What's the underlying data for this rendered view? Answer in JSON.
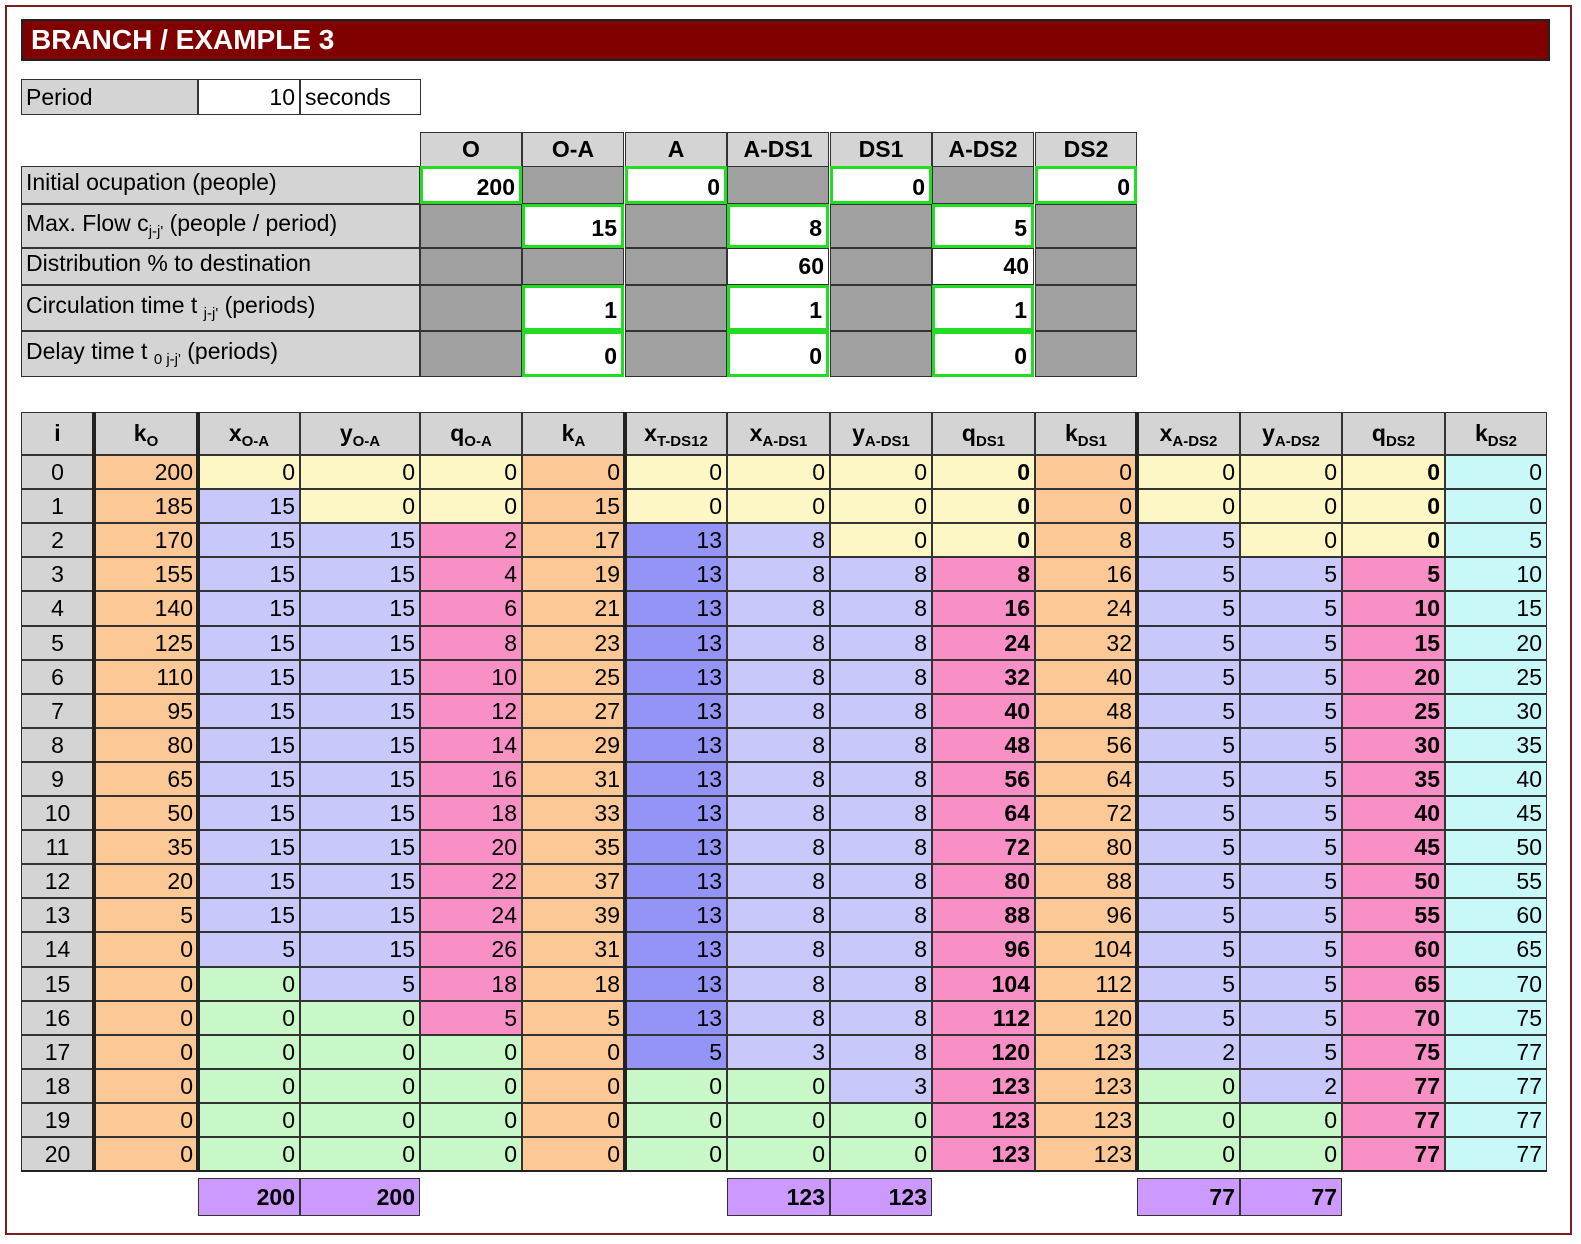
{
  "title": "BRANCH / EXAMPLE 3",
  "period": {
    "label": "Period",
    "value": "10",
    "unit": "seconds"
  },
  "params": {
    "columns": [
      "O",
      "O-A",
      "A",
      "A-DS1",
      "DS1",
      "A-DS2",
      "DS2"
    ],
    "rows": [
      {
        "label": "Initial ocupation (people)",
        "cells": [
          "200",
          null,
          "0",
          null,
          "0",
          null,
          "0"
        ]
      },
      {
        "label": "Max. Flow c",
        "sub": "j-j'",
        "label_after": " (people / period)",
        "cells": [
          null,
          "15",
          null,
          "8",
          null,
          "5",
          null
        ]
      },
      {
        "label": "Distribution %  to destination",
        "cells": [
          null,
          "",
          null,
          "60",
          null,
          "40",
          null
        ]
      },
      {
        "label": "Circulation time t ",
        "sub": "j-j'",
        "label_after": " (periods)",
        "cells": [
          null,
          "1",
          null,
          "1",
          null,
          "1",
          null
        ]
      },
      {
        "label": "Delay time t ",
        "sub": "0 j-j'",
        "label_after": " (periods)",
        "cells": [
          null,
          "0",
          null,
          "0",
          null,
          "0",
          null
        ]
      }
    ]
  },
  "table": {
    "headers": [
      {
        "main": "i",
        "sub": ""
      },
      {
        "main": "k",
        "sub": "O"
      },
      {
        "main": "x",
        "sub": "O-A"
      },
      {
        "main": "y",
        "sub": "O-A"
      },
      {
        "main": "q",
        "sub": "O-A"
      },
      {
        "main": "k",
        "sub": "A"
      },
      {
        "main": "x",
        "sub": "T-DS12"
      },
      {
        "main": "x",
        "sub": "A-DS1"
      },
      {
        "main": "y",
        "sub": "A-DS1"
      },
      {
        "main": "q",
        "sub": "DS1"
      },
      {
        "main": "k",
        "sub": "DS1"
      },
      {
        "main": "x",
        "sub": "A-DS2"
      },
      {
        "main": "y",
        "sub": "A-DS2"
      },
      {
        "main": "q",
        "sub": "DS2"
      },
      {
        "main": "k",
        "sub": "DS2"
      }
    ],
    "rows": [
      [
        "0",
        "200",
        "0",
        "0",
        "0",
        "0",
        "0",
        "0",
        "0",
        "0",
        "0",
        "0",
        "0",
        "0",
        "0"
      ],
      [
        "1",
        "185",
        "15",
        "0",
        "0",
        "15",
        "0",
        "0",
        "0",
        "0",
        "0",
        "0",
        "0",
        "0",
        "0"
      ],
      [
        "2",
        "170",
        "15",
        "15",
        "2",
        "17",
        "13",
        "8",
        "0",
        "0",
        "8",
        "5",
        "0",
        "0",
        "5"
      ],
      [
        "3",
        "155",
        "15",
        "15",
        "4",
        "19",
        "13",
        "8",
        "8",
        "8",
        "16",
        "5",
        "5",
        "5",
        "10"
      ],
      [
        "4",
        "140",
        "15",
        "15",
        "6",
        "21",
        "13",
        "8",
        "8",
        "16",
        "24",
        "5",
        "5",
        "10",
        "15"
      ],
      [
        "5",
        "125",
        "15",
        "15",
        "8",
        "23",
        "13",
        "8",
        "8",
        "24",
        "32",
        "5",
        "5",
        "15",
        "20"
      ],
      [
        "6",
        "110",
        "15",
        "15",
        "10",
        "25",
        "13",
        "8",
        "8",
        "32",
        "40",
        "5",
        "5",
        "20",
        "25"
      ],
      [
        "7",
        "95",
        "15",
        "15",
        "12",
        "27",
        "13",
        "8",
        "8",
        "40",
        "48",
        "5",
        "5",
        "25",
        "30"
      ],
      [
        "8",
        "80",
        "15",
        "15",
        "14",
        "29",
        "13",
        "8",
        "8",
        "48",
        "56",
        "5",
        "5",
        "30",
        "35"
      ],
      [
        "9",
        "65",
        "15",
        "15",
        "16",
        "31",
        "13",
        "8",
        "8",
        "56",
        "64",
        "5",
        "5",
        "35",
        "40"
      ],
      [
        "10",
        "50",
        "15",
        "15",
        "18",
        "33",
        "13",
        "8",
        "8",
        "64",
        "72",
        "5",
        "5",
        "40",
        "45"
      ],
      [
        "11",
        "35",
        "15",
        "15",
        "20",
        "35",
        "13",
        "8",
        "8",
        "72",
        "80",
        "5",
        "5",
        "45",
        "50"
      ],
      [
        "12",
        "20",
        "15",
        "15",
        "22",
        "37",
        "13",
        "8",
        "8",
        "80",
        "88",
        "5",
        "5",
        "50",
        "55"
      ],
      [
        "13",
        "5",
        "15",
        "15",
        "24",
        "39",
        "13",
        "8",
        "8",
        "88",
        "96",
        "5",
        "5",
        "55",
        "60"
      ],
      [
        "14",
        "0",
        "5",
        "15",
        "26",
        "31",
        "13",
        "8",
        "8",
        "96",
        "104",
        "5",
        "5",
        "60",
        "65"
      ],
      [
        "15",
        "0",
        "0",
        "5",
        "18",
        "18",
        "13",
        "8",
        "8",
        "104",
        "112",
        "5",
        "5",
        "65",
        "70"
      ],
      [
        "16",
        "0",
        "0",
        "0",
        "5",
        "5",
        "13",
        "8",
        "8",
        "112",
        "120",
        "5",
        "5",
        "70",
        "75"
      ],
      [
        "17",
        "0",
        "0",
        "0",
        "0",
        "0",
        "5",
        "3",
        "8",
        "120",
        "123",
        "2",
        "5",
        "75",
        "77"
      ],
      [
        "18",
        "0",
        "0",
        "0",
        "0",
        "0",
        "0",
        "0",
        "3",
        "123",
        "123",
        "0",
        "2",
        "77",
        "77"
      ],
      [
        "19",
        "0",
        "0",
        "0",
        "0",
        "0",
        "0",
        "0",
        "0",
        "123",
        "123",
        "0",
        "0",
        "77",
        "77"
      ],
      [
        "20",
        "0",
        "0",
        "0",
        "0",
        "0",
        "0",
        "0",
        "0",
        "123",
        "123",
        "0",
        "0",
        "77",
        "77"
      ]
    ],
    "totals": {
      "x_OA": "200",
      "y_OA": "200",
      "x_ADS1": "123",
      "y_ADS1": "123",
      "x_ADS2": "77",
      "y_ADS2": "77"
    }
  },
  "colors": {
    "title_bg": "#800000",
    "header_gray": "#d4d4d4",
    "disabled_gray": "#a0a0a0",
    "input_border": "#22dd22",
    "k_orange": "#fcc896",
    "light_yellow": "#fcf7c4",
    "lavender": "#c8c8fa",
    "pink": "#f890c6",
    "blue": "#9494f6",
    "light_green": "#c8f8c8",
    "light_cyan": "#c8f8f8",
    "total_purple": "#cc99ff"
  }
}
